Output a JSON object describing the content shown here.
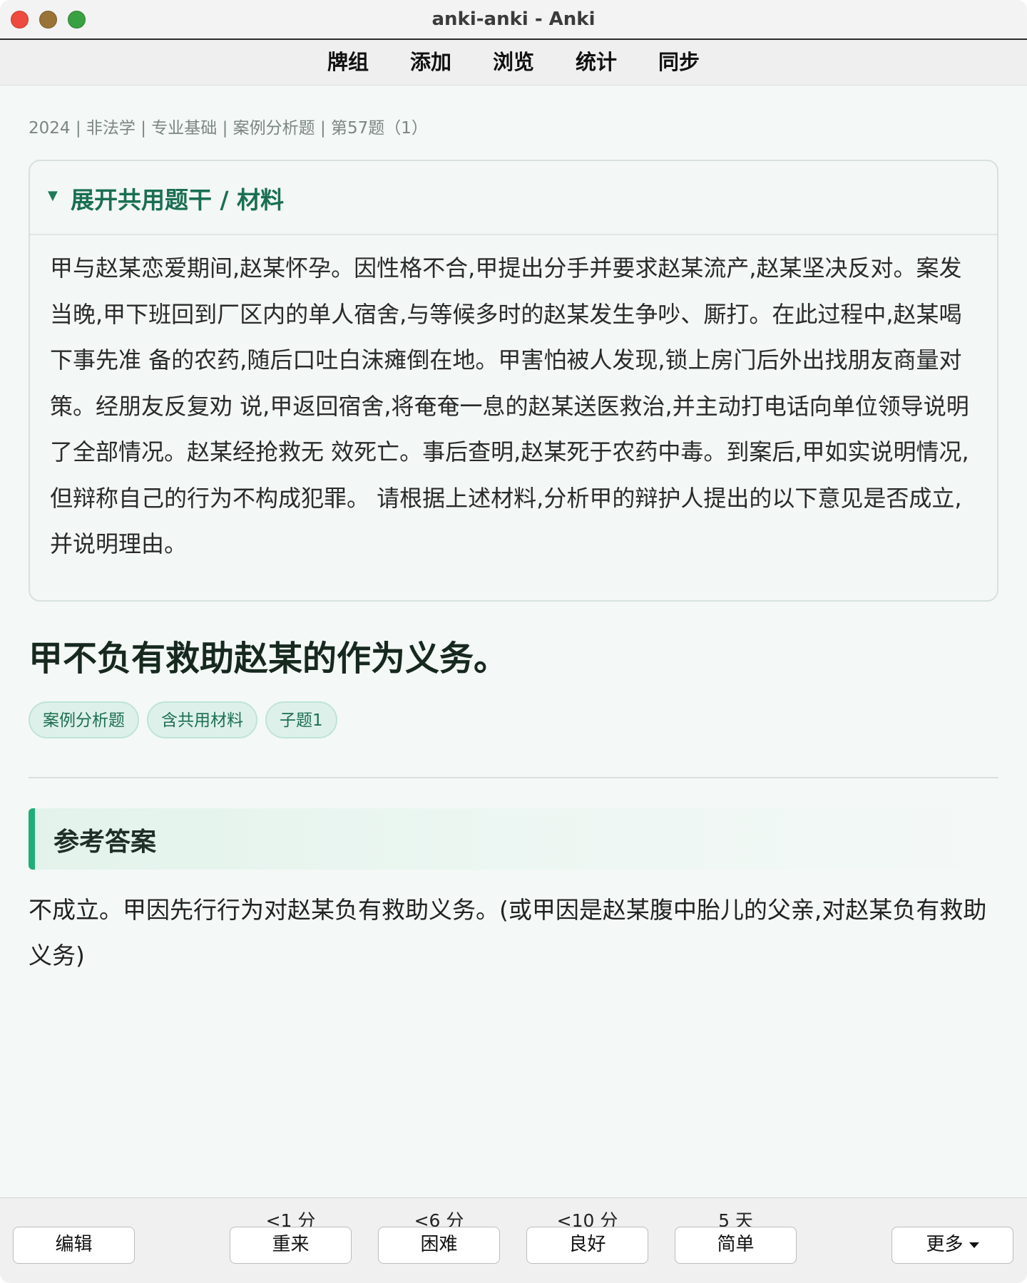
{
  "window": {
    "title": "anki-anki - Anki"
  },
  "toolbar": {
    "items": [
      "牌组",
      "添加",
      "浏览",
      "统计",
      "同步"
    ]
  },
  "card": {
    "breadcrumb": "2024 | 非法学 | 专业基础 | 案例分析题 | 第57题（1）",
    "material_toggle": "展开共用题干 / 材料",
    "material_text": "甲与赵某恋爱期间,赵某怀孕。因性格不合,甲提出分手并要求赵某流产,赵某坚决反对。案发 当晚,甲下班回到厂区内的单人宿舍,与等候多时的赵某发生争吵、厮打。在此过程中,赵某喝下事先准 备的农药,随后口吐白沫瘫倒在地。甲害怕被人发现,锁上房门后外出找朋友商量对策。经朋友反复劝 说,甲返回宿舍,将奄奄一息的赵某送医救治,并主动打电话向单位领导说明了全部情况。赵某经抢救无 效死亡。事后查明,赵某死于农药中毒。到案后,甲如实说明情况,但辩称自己的行为不构成犯罪。 请根据上述材料,分析甲的辩护人提出的以下意见是否成立,并说明理由。",
    "question": "甲不负有救助赵某的作为义务。",
    "tags": [
      "案例分析题",
      "含共用材料",
      "子题1"
    ],
    "answer_heading": "参考答案",
    "answer_text": "不成立。甲因先行行为对赵某负有救助义务。(或甲因是赵某腹中胎儿的父亲,对赵某负有救助义务)"
  },
  "bottom": {
    "edit_label": "编辑",
    "more_label": "更多",
    "answers": [
      {
        "due": "<1 分",
        "label": "重来"
      },
      {
        "due": "<6 分",
        "label": "困难"
      },
      {
        "due": "<10 分",
        "label": "良好"
      },
      {
        "due": "5 天",
        "label": "简单"
      }
    ]
  },
  "colors": {
    "accent": "#1a6f52",
    "answer_bar": "#1fae78",
    "background": "#f4f8f7"
  }
}
